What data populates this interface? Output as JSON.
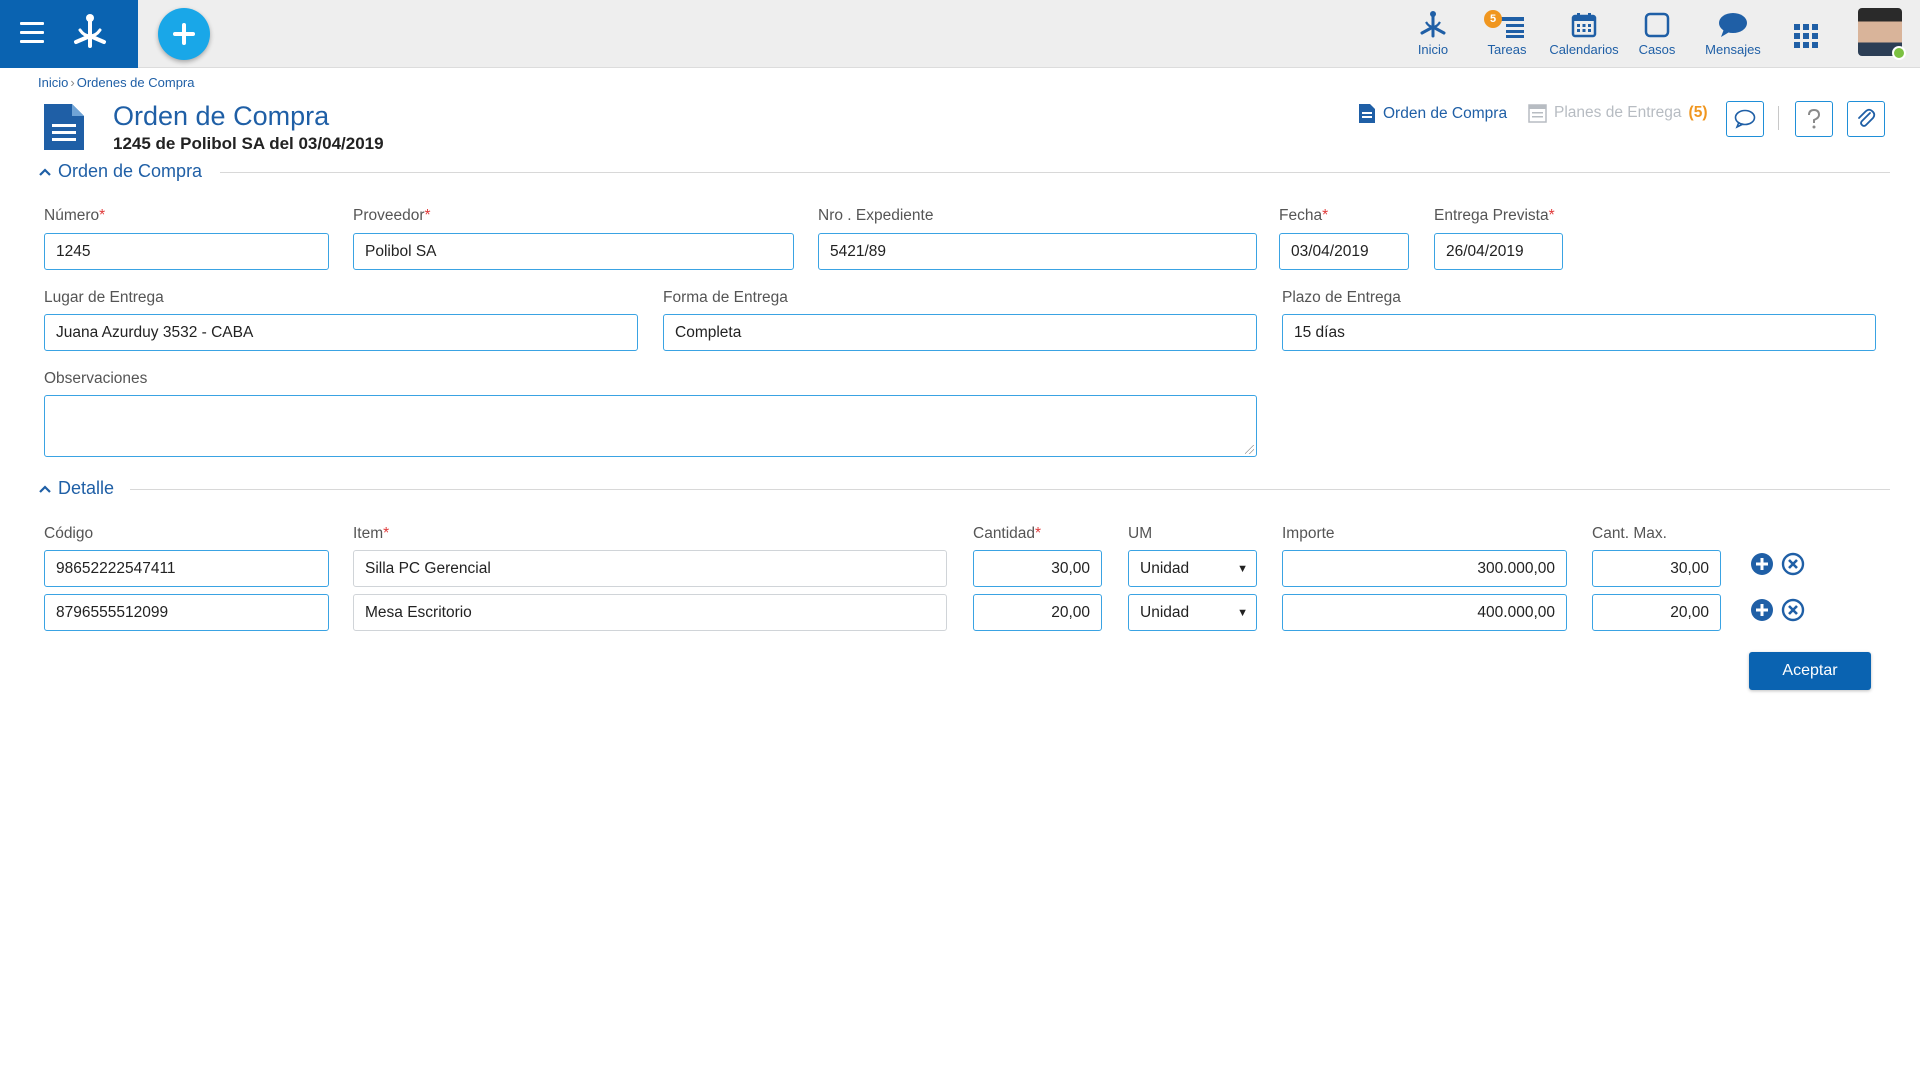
{
  "nav": {
    "items": [
      {
        "label": "Inicio",
        "icon": "home-network-icon"
      },
      {
        "label": "Tareas",
        "icon": "tasks-icon",
        "badge": "5"
      },
      {
        "label": "Calendarios",
        "icon": "calendar-icon"
      },
      {
        "label": "Casos",
        "icon": "cases-icon"
      },
      {
        "label": "Mensajes",
        "icon": "messages-icon"
      }
    ]
  },
  "breadcrumb": {
    "home": "Inicio",
    "sep": "›",
    "current": "Ordenes de Compra"
  },
  "header": {
    "title": "Orden de Compra",
    "subtitle": "1245 de Polibol SA del 03/04/2019"
  },
  "toolbar": {
    "order_link": "Orden de Compra",
    "plans_link": "Planes de Entrega",
    "plans_count": "(5)"
  },
  "section_order": {
    "title": "Orden de Compra"
  },
  "fields": {
    "numero": {
      "label": "Número",
      "value": "1245"
    },
    "proveedor": {
      "label": "Proveedor",
      "value": "Polibol SA"
    },
    "expediente": {
      "label": "Nro . Expediente",
      "value": "5421/89"
    },
    "fecha": {
      "label": "Fecha",
      "value": "03/04/2019"
    },
    "entrega_prevista": {
      "label": "Entrega Prevista",
      "value": "26/04/2019"
    },
    "lugar": {
      "label": "Lugar de Entrega",
      "value": "Juana Azurduy 3532 - CABA"
    },
    "forma": {
      "label": "Forma de Entrega",
      "value": "Completa"
    },
    "plazo": {
      "label": "Plazo de Entrega",
      "value": "15 días"
    },
    "observaciones": {
      "label": "Observaciones",
      "value": ""
    }
  },
  "section_detail": {
    "title": "Detalle"
  },
  "detail": {
    "columns": {
      "codigo": "Código",
      "item": "Item",
      "cantidad": "Cantidad",
      "um": "UM",
      "importe": "Importe",
      "cant_max": "Cant. Max."
    },
    "rows": [
      {
        "codigo": "98652222547411",
        "item": "Silla PC Gerencial",
        "cantidad": "30,00",
        "um": "Unidad",
        "importe": "300.000,00",
        "cant_max": "30,00"
      },
      {
        "codigo": "8796555512099",
        "item": "Mesa Escritorio",
        "cantidad": "20,00",
        "um": "Unidad",
        "importe": "400.000,00",
        "cant_max": "20,00"
      }
    ]
  },
  "actions": {
    "accept": "Aceptar"
  },
  "required_mark": "*",
  "colors": {
    "primary": "#0a63b1",
    "link": "#1f5fa6",
    "fab": "#19a7e8",
    "badge": "#f0961f",
    "input_border": "#3aa3e3",
    "required": "#e03a3a"
  }
}
